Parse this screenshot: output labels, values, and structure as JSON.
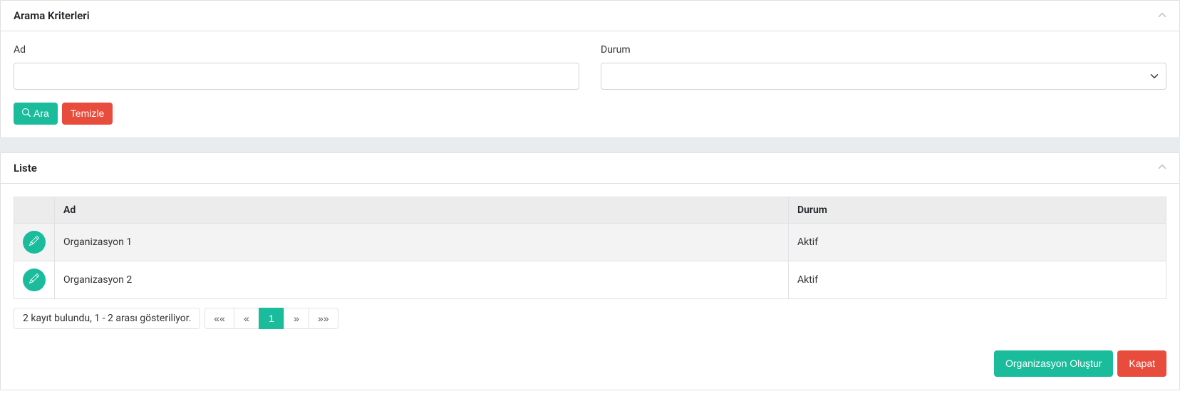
{
  "searchPanel": {
    "title": "Arama Kriterleri",
    "nameLabel": "Ad",
    "nameValue": "",
    "statusLabel": "Durum",
    "statusValue": "",
    "searchButton": "Ara",
    "clearButton": "Temizle"
  },
  "listPanel": {
    "title": "Liste",
    "headers": {
      "name": "Ad",
      "status": "Durum"
    },
    "rows": [
      {
        "name": "Organizasyon 1",
        "status": "Aktif"
      },
      {
        "name": "Organizasyon 2",
        "status": "Aktif"
      }
    ],
    "pagination": {
      "info": "2 kayıt bulundu, 1 - 2 arası gösteriliyor.",
      "first": "««",
      "prev": "«",
      "current": "1",
      "next": "»",
      "last": "»»"
    },
    "createButton": "Organizasyon Oluştur",
    "closeButton": "Kapat"
  },
  "colors": {
    "primary": "#1abc9c",
    "danger": "#e74c3c"
  }
}
